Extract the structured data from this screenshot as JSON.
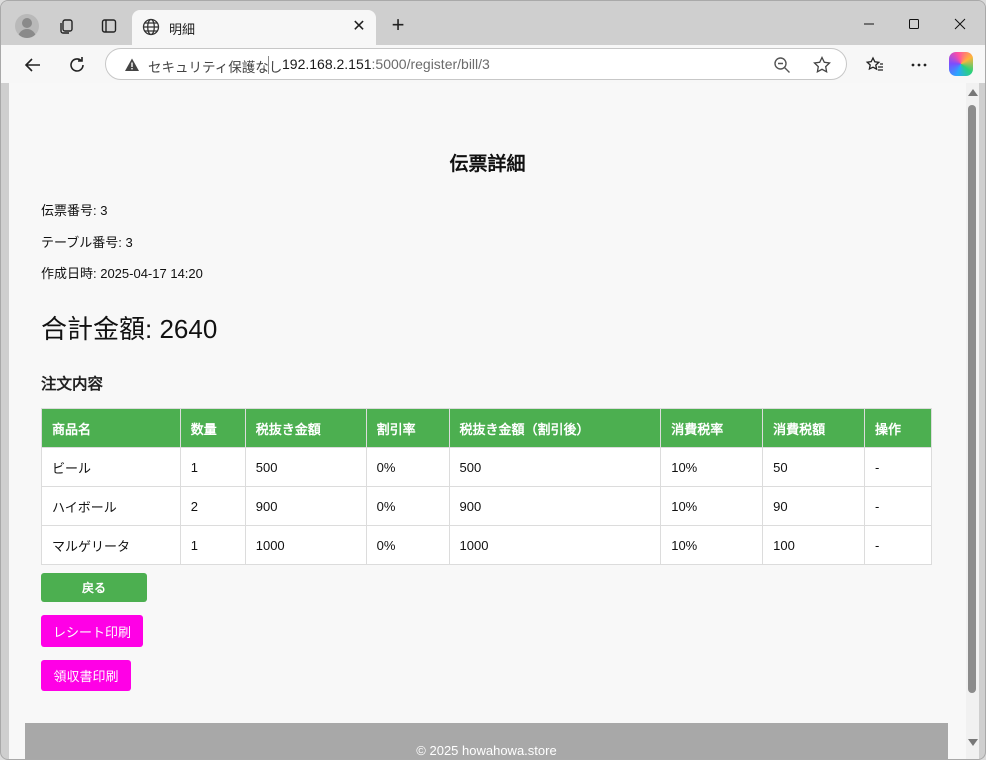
{
  "browser": {
    "tab_title": "明細",
    "tab_close_glyph": "✕",
    "new_tab_glyph": "+",
    "security_label": "セキュリティ保護なし",
    "url_host": "192.168.2.151",
    "url_rest": ":5000/register/bill/3",
    "icons": [
      "profile-icon",
      "collections-icon",
      "tab-actions-icon",
      "globe-icon",
      "back-icon",
      "refresh-icon",
      "warning-icon",
      "zoom-out-icon",
      "favorite-star-icon",
      "favorites-icon",
      "more-icon",
      "copilot-icon"
    ]
  },
  "page": {
    "title": "伝票詳細",
    "bill_number": "伝票番号: 3",
    "table_number": "テーブル番号: 3",
    "created_at": "作成日時: 2025-04-17 14:20",
    "total": "合計金額: 2640",
    "orders_heading": "注文内容",
    "table": {
      "headers": [
        "商品名",
        "数量",
        "税抜き金額",
        "割引率",
        "税抜き金額（割引後）",
        "消費税率",
        "消費税額",
        "操作"
      ],
      "rows": [
        [
          "ビール",
          "1",
          "500",
          "0%",
          "500",
          "10%",
          "50",
          "-"
        ],
        [
          "ハイボール",
          "2",
          "900",
          "0%",
          "900",
          "10%",
          "90",
          "-"
        ],
        [
          "マルゲリータ",
          "1",
          "1000",
          "0%",
          "1000",
          "10%",
          "100",
          "-"
        ]
      ]
    },
    "back_button": "戻る",
    "receipt_button": "レシート印刷",
    "ryoshu_button": "領収書印刷",
    "footer": "© 2025 howahowa.store"
  },
  "colors": {
    "accent_green": "#4caf50",
    "print_magenta": "#ff00e6",
    "footer_gray": "#a8a8a8"
  }
}
